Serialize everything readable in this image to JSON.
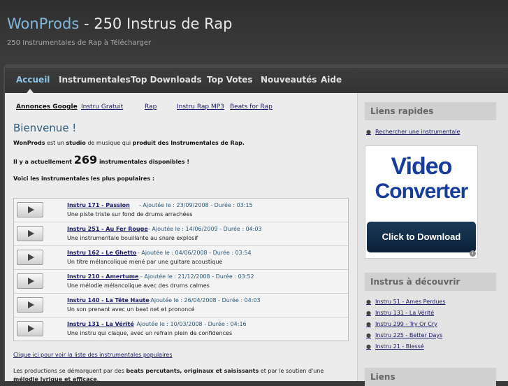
{
  "header": {
    "brand": "WonProds",
    "title_rest": " - 250 Instrus de Rap",
    "tagline": "250 Instrumentales de Rap à Télécharger"
  },
  "nav": [
    {
      "label": "Accueil"
    },
    {
      "label": "Instrumentales"
    },
    {
      "label": "Top Downloads"
    },
    {
      "label": "Top Votes"
    },
    {
      "label": "Nouveautés"
    },
    {
      "label": "Aide"
    }
  ],
  "toplinks": [
    "Annonces Google",
    "Instru Gratuit",
    "Rap",
    "Instru Rap MP3",
    "Beats for Rap"
  ],
  "welcome": {
    "title": "Bienvenue !",
    "p1_a": "WonProds",
    "p1_b": " est un ",
    "p1_c": "studio",
    "p1_d": " de musique qui ",
    "p1_e": "produit des Instrumentales de Rap.",
    "p2_a": "Il y a actuellement ",
    "count": "269",
    "p2_b": " instrumentales disponibles !",
    "p3": "Voici les instrumentales les plus populaires :"
  },
  "tracks": [
    {
      "title": "Instru 171 - Passion",
      "meta": " - Ajoutée le : 23/09/2008 - Durée : 03:15",
      "desc": "Une piste triste sur fond de drums arrachées"
    },
    {
      "title": "Instru 251 - Au Fer Rouge",
      "meta": " - Ajoutée le : 14/06/2009 - Durée : 04:03",
      "desc": "Une instrumentale bouillante au snare explosif"
    },
    {
      "title": "Instru 162 - Le Ghetto",
      "meta": " - Ajoutée le : 04/06/2008 - Durée : 03:54",
      "desc": "Un titre mélancolique mené par une guitare acoustique"
    },
    {
      "title": "Instru 210 - Amertume",
      "meta": " - Ajoutée le : 21/12/2008 - Durée : 03:52",
      "desc": "Une mélodie mélancolique avec des drums calmes"
    },
    {
      "title": "Instru 140 - La Tête Haute",
      "meta": " - Ajoutée le : 26/04/2008 - Durée : 04:03",
      "desc": "Un son prenant avec un beat net et prononcé"
    },
    {
      "title": "Instru 131 - La Vérité",
      "meta": " - Ajoutée le : 10/03/2008 - Durée : 04:16",
      "desc": "Une instru qui claque, avec un refrain plein de confidences"
    }
  ],
  "popular_link": "Clique ici pour voir la liste des instrumentales populaires",
  "bottom": {
    "a": "Les productions se démarquent par des ",
    "b": "beats percutants, originaux et saisissants",
    "c": " et par le soutien d'une ",
    "d": "mélodie lyrique et efficace",
    "e": "."
  },
  "sidebar": {
    "quick_title": "Liens rapides",
    "quick_link": "Rechercher une instrumentale",
    "ad": {
      "line1": "Video",
      "line2": "Converter",
      "button": "Click to Download",
      "info": "i"
    },
    "discover_title": "Instrus à découvrir",
    "discover": [
      "Instru 51 - Ames Perdues",
      "Instru 131 - La Vérité",
      "Instru 299 - Try Or Cry",
      "Instru 225 - Better Days",
      "Instru 21 - Blessé"
    ],
    "links_title": "Liens"
  }
}
